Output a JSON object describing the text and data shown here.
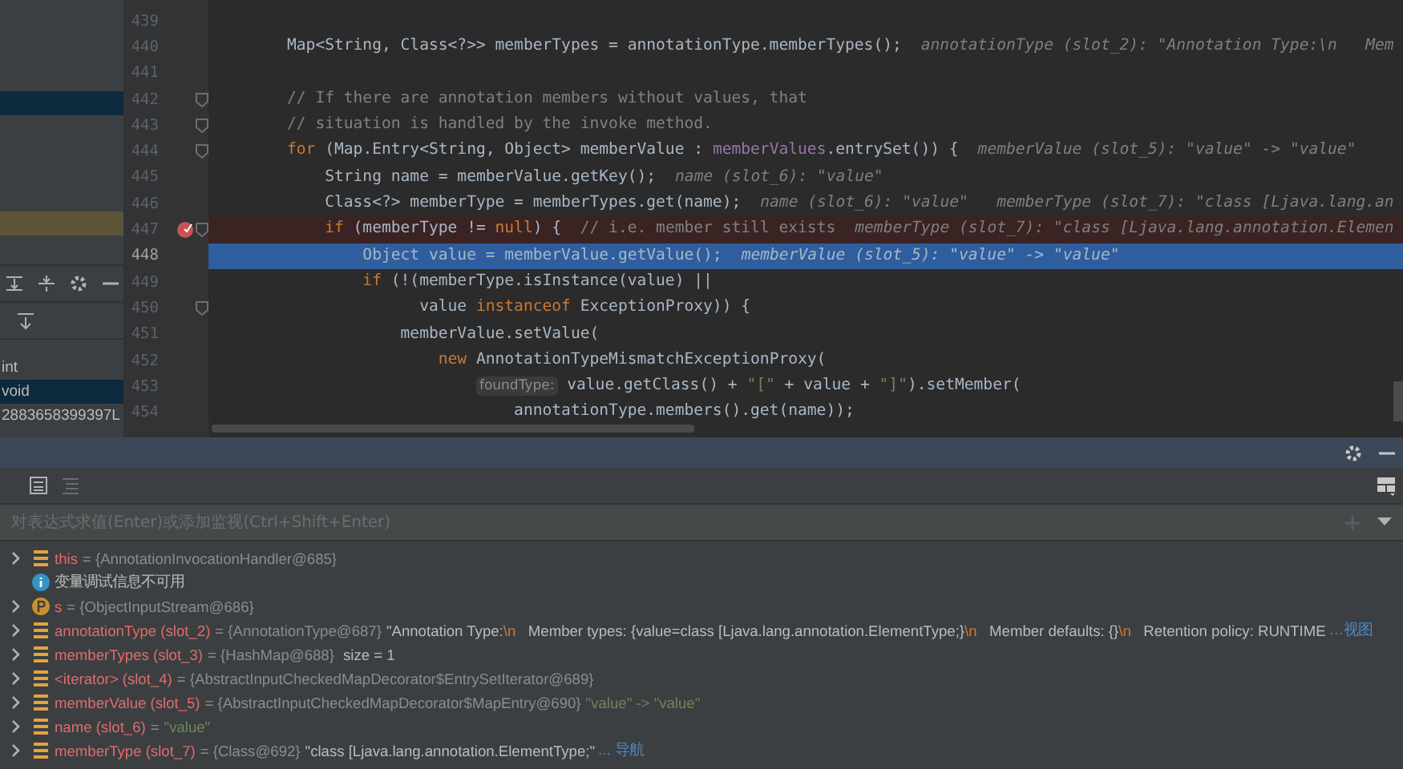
{
  "frames": [
    {
      "selected": false,
      "highlighted": false
    },
    {
      "selected": false,
      "highlighted": false
    },
    {
      "selected": false,
      "highlighted": false
    },
    {
      "selected": true,
      "highlighted": false
    },
    {
      "selected": false,
      "highlighted": false
    },
    {
      "selected": false,
      "highlighted": false
    },
    {
      "selected": false,
      "highlighted": false
    },
    {
      "selected": false,
      "highlighted": false
    },
    {
      "selected": false,
      "highlighted": true
    },
    {
      "selected": false,
      "highlighted": false
    }
  ],
  "watches": [
    {
      "text": "int",
      "selected": false
    },
    {
      "text": "void",
      "selected": true
    },
    {
      "text": "2883658399397L",
      "selected": false
    }
  ],
  "code_lines": [
    {
      "number": "439",
      "kind": "normal",
      "breakpoint": false,
      "fold": false
    },
    {
      "number": "440",
      "kind": "normal",
      "breakpoint": false,
      "fold": false,
      "segments": [
        {
          "kind": "txt",
          "text": "Map<String, Class<?>> memberTypes = annotationType.memberTypes();"
        },
        {
          "kind": "hint",
          "text": "annotationType (slot_2): \"Annotation Type:\\n   Mem"
        }
      ]
    },
    {
      "number": "441",
      "kind": "normal",
      "breakpoint": false,
      "fold": false
    },
    {
      "number": "442",
      "kind": "normal",
      "breakpoint": false,
      "fold": true,
      "segments": [
        {
          "kind": "cmt",
          "text": "// If there are annotation members without values, that"
        }
      ]
    },
    {
      "number": "443",
      "kind": "normal",
      "breakpoint": false,
      "fold": true,
      "segments": [
        {
          "kind": "cmt",
          "text": "// situation is handled by the invoke method."
        }
      ]
    },
    {
      "number": "444",
      "kind": "normal",
      "breakpoint": false,
      "fold": true,
      "segments": [
        {
          "kind": "kw",
          "text": "for"
        },
        {
          "kind": "txt",
          "text": " (Map.Entry<String, Object> memberValue : "
        },
        {
          "kind": "fld",
          "text": "memberValues"
        },
        {
          "kind": "txt",
          "text": ".entrySet()) {"
        },
        {
          "kind": "hint",
          "text": "memberValue (slot_5): \"value\" -> \"value\""
        }
      ]
    },
    {
      "number": "445",
      "kind": "normal",
      "breakpoint": false,
      "fold": false,
      "segments": [
        {
          "kind": "txt",
          "text": "    String name = memberValue.getKey();"
        },
        {
          "kind": "hint",
          "text": "name (slot_6): \"value\""
        }
      ]
    },
    {
      "number": "446",
      "kind": "normal",
      "breakpoint": false,
      "fold": false,
      "segments": [
        {
          "kind": "txt",
          "text": "    Class<?> memberType = memberTypes.get(name);"
        },
        {
          "kind": "hint",
          "text": "name (slot_6): \"value\"   memberType (slot_7): \"class [Ljava.lang.an"
        }
      ]
    },
    {
      "number": "447",
      "kind": "breakpoint",
      "breakpoint": true,
      "fold": true,
      "segments": [
        {
          "kind": "kw",
          "text": "    if"
        },
        {
          "kind": "txt",
          "text": " (memberType != "
        },
        {
          "kind": "kw",
          "text": "null"
        },
        {
          "kind": "txt",
          "text": ") {  "
        },
        {
          "kind": "cmt",
          "text": "// i.e. member still exists"
        },
        {
          "kind": "hint",
          "text": "memberType (slot_7): \"class [Ljava.lang.annotation.Elemen"
        }
      ]
    },
    {
      "number": "448",
      "kind": "execution",
      "breakpoint": false,
      "fold": false,
      "segments": [
        {
          "kind": "txt",
          "text": "        Object value = memberValue.getValue();"
        },
        {
          "kind": "hint",
          "text": "memberValue (slot_5): \"value\" -> \"value\""
        }
      ]
    },
    {
      "number": "449",
      "kind": "normal",
      "breakpoint": false,
      "fold": false,
      "segments": [
        {
          "kind": "kw",
          "text": "        if"
        },
        {
          "kind": "txt",
          "text": " (!(memberType.isInstance(value) ||"
        }
      ]
    },
    {
      "number": "450",
      "kind": "normal",
      "breakpoint": false,
      "fold": true,
      "segments": [
        {
          "kind": "txt",
          "text": "              value "
        },
        {
          "kind": "kw",
          "text": "instanceof"
        },
        {
          "kind": "txt",
          "text": " ExceptionProxy)) {"
        }
      ]
    },
    {
      "number": "451",
      "kind": "normal",
      "breakpoint": false,
      "fold": false,
      "segments": [
        {
          "kind": "txt",
          "text": "            memberValue.setValue("
        }
      ]
    },
    {
      "number": "452",
      "kind": "normal",
      "breakpoint": false,
      "fold": false,
      "segments": [
        {
          "kind": "kw",
          "text": "                new"
        },
        {
          "kind": "txt",
          "text": " AnnotationTypeMismatchExceptionProxy("
        }
      ]
    },
    {
      "number": "453",
      "kind": "normal",
      "breakpoint": false,
      "fold": false,
      "segments": [
        {
          "kind": "tag",
          "text": "foundType:"
        },
        {
          "kind": "txt",
          "text": " value.getClass() + "
        },
        {
          "kind": "str",
          "text": "\"[\""
        },
        {
          "kind": "txt",
          "text": " + value + "
        },
        {
          "kind": "str",
          "text": "\"]\""
        },
        {
          "kind": "txt",
          "text": ").setMember("
        }
      ]
    },
    {
      "number": "454",
      "kind": "normal",
      "breakpoint": false,
      "fold": false,
      "segments": [
        {
          "kind": "txt",
          "text": "                        annotationType.members().get(name));"
        }
      ]
    }
  ],
  "evaluate": {
    "placeholder": "对表达式求值(Enter)或添加监视(Ctrl+Shift+Enter)"
  },
  "variables": [
    {
      "kind": "field",
      "expandable": true,
      "name": "this",
      "type": "= {AnnotationInvocationHandler@685}"
    },
    {
      "kind": "info",
      "expandable": false,
      "name": "变量调试信息不可用"
    },
    {
      "kind": "param",
      "expandable": true,
      "name": "s",
      "type": "= {ObjectInputStream@686}"
    },
    {
      "kind": "field",
      "expandable": true,
      "name": "annotationType (slot_2)",
      "type": "= {AnnotationType@687}",
      "value": [
        {
          "kind": "text",
          "text": "\"Annotation Type:"
        },
        {
          "kind": "escape",
          "text": "\\n"
        },
        {
          "kind": "text",
          "text": "   Member types: {value=class [Ljava.lang.annotation.ElementType;}"
        },
        {
          "kind": "escape",
          "text": "\\n"
        },
        {
          "kind": "text",
          "text": "   Member defaults: {}"
        },
        {
          "kind": "escape",
          "text": "\\n"
        },
        {
          "kind": "text",
          "text": "   Retention policy: RUNTIME"
        }
      ],
      "link": "…视图"
    },
    {
      "kind": "field",
      "expandable": true,
      "name": "memberTypes (slot_3)",
      "type": "= {HashMap@688}",
      "value": [
        {
          "kind": "text",
          "text": " size = 1"
        }
      ]
    },
    {
      "kind": "field",
      "expandable": true,
      "name": "<iterator> (slot_4)",
      "type": "= {AbstractInputCheckedMapDecorator$EntrySetIterator@689}"
    },
    {
      "kind": "field",
      "expandable": true,
      "name": "memberValue (slot_5)",
      "type": "= {AbstractInputCheckedMapDecorator$MapEntry@690}",
      "value": [
        {
          "kind": "string",
          "text": "\"value\" -> \"value\""
        }
      ]
    },
    {
      "kind": "field",
      "expandable": true,
      "name": "name (slot_6)",
      "type": "=",
      "value": [
        {
          "kind": "string",
          "text": "\"value\""
        }
      ]
    },
    {
      "kind": "field",
      "expandable": true,
      "name": "memberType (slot_7)",
      "type": "= {Class@692}",
      "value": [
        {
          "kind": "text",
          "text": "\"class [Ljava.lang.annotation.ElementType;\""
        }
      ],
      "link": "... 导航"
    }
  ]
}
